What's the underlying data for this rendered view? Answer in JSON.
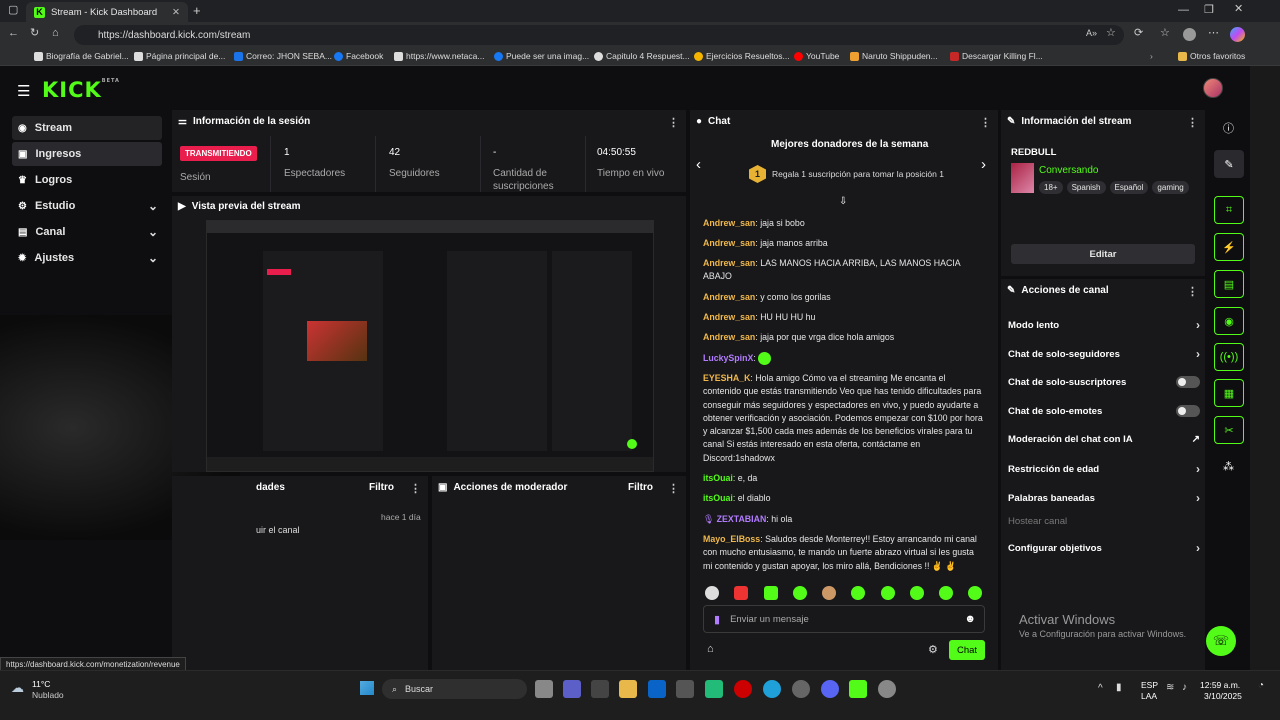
{
  "browser": {
    "tab_title": "Stream - Kick Dashboard",
    "url": "https://dashboard.kick.com/stream",
    "bookmarks": [
      "Biografía de Gabriel...",
      "Página principal de...",
      "Correo: JHON SEBA...",
      "Facebook",
      "https://www.netaca...",
      "Puede ser una imag...",
      "Capitulo 4 Respuest...",
      "Ejercicios Resueltos...",
      "YouTube",
      "Naruto Shippuden...",
      "Descargar Killing Fl...",
      "Otros favoritos"
    ],
    "status_url": "https://dashboard.kick.com/monetization/revenue"
  },
  "app": {
    "logo": "KICK",
    "logo_badge": "BETA"
  },
  "sidebar": {
    "items": [
      {
        "label": "Stream",
        "icon": "broadcast-icon"
      },
      {
        "label": "Ingresos",
        "icon": "wallet-icon"
      },
      {
        "label": "Logros",
        "icon": "trophy-icon"
      },
      {
        "label": "Estudio",
        "icon": "sliders-icon"
      },
      {
        "label": "Canal",
        "icon": "channel-icon"
      },
      {
        "label": "Ajustes",
        "icon": "gear-icon"
      }
    ]
  },
  "session": {
    "title": "Información de la sesión",
    "status_badge": "TRANSMITIENDO",
    "session_label": "Sesión",
    "viewers": "1",
    "viewers_label": "Espectadores",
    "followers": "42",
    "followers_label": "Seguidores",
    "subs": "-",
    "subs_label": "Cantidad de suscripciones",
    "time": "04:50:55",
    "time_label": "Tiempo en vivo"
  },
  "preview": {
    "title": "Vista previa del stream"
  },
  "activity": {
    "title": "dades",
    "filter": "Filtro",
    "time": "hace 1 día",
    "text": "uir el canal"
  },
  "mod_actions": {
    "title": "Acciones de moderador",
    "filter": "Filtro"
  },
  "chat": {
    "title": "Chat",
    "top_donors": "Mejores donadores de la semana",
    "donor_rank": "1",
    "donor_text": "Regala 1 suscripción para tomar la posición 1",
    "messages": [
      {
        "user": "Andrew_san",
        "text": "jaja si bobo",
        "color": "#f0b84a"
      },
      {
        "user": "Andrew_san",
        "text": "jaja manos arriba",
        "color": "#f0b84a"
      },
      {
        "user": "Andrew_san",
        "text": "LAS MANOS HACIA ARRIBA, LAS MANOS HACIA ABAJO",
        "color": "#f0b84a"
      },
      {
        "user": "Andrew_san",
        "text": "y como los gorilas",
        "color": "#f0b84a"
      },
      {
        "user": "Andrew_san",
        "text": "HU HU HU hu",
        "color": "#f0b84a"
      },
      {
        "user": "Andrew_san",
        "text": "jaja por que vrga dice hola amigos",
        "color": "#f0b84a"
      },
      {
        "user": "LuckySpinX",
        "text": "",
        "color": "#b27cff"
      },
      {
        "user": "EYESHA_K",
        "text": "Hola amigo Cómo va el streaming Me encanta el contenido que estás transmitiendo Veo que has tenido dificultades para conseguir más seguidores y espectadores en vivo, y puedo ayudarte a obtener verificación y asociación. Podemos empezar con $100 por hora y alcanzar $1,500 cada mes además de los beneficios virales para tu canal Si estás interesado en esta oferta, contáctame en Discord:1shadowx",
        "color": "#f0b84a"
      },
      {
        "user": "itsOuai",
        "text": "e, da",
        "color": "#53fc18"
      },
      {
        "user": "itsOuai",
        "text": "el diablo",
        "color": "#53fc18"
      },
      {
        "user": "ZEXTABIAN",
        "text": "hi ola",
        "color": "#b27cff"
      },
      {
        "user": "Mayo_ElBoss",
        "text": "Saludos desde Monterrey!! Estoy arrancando mi canal con mucho entusiasmo, te mando un fuerte abrazo virtual si les gusta mi contenido y gustan apoyar, los miro allá, Bendiciones !! ✌️ ✌️",
        "color": "#f0b84a"
      }
    ],
    "placeholder": "Enviar un mensaje",
    "send": "Chat"
  },
  "stream_info": {
    "title": "Información del stream",
    "stream_title": "REDBULL",
    "category": "Conversando",
    "tags": [
      "18+",
      "Spanish",
      "Español",
      "gaming"
    ],
    "edit": "Editar"
  },
  "channel_actions": {
    "title": "Acciones de canal",
    "items": [
      {
        "label": "Modo lento",
        "control": "chevron"
      },
      {
        "label": "Chat de solo-seguidores",
        "control": "chevron"
      },
      {
        "label": "Chat de solo-suscriptores",
        "control": "toggle"
      },
      {
        "label": "Chat de solo-emotes",
        "control": "toggle"
      },
      {
        "label": "Moderación del chat con IA",
        "control": "external"
      },
      {
        "label": "Restricción de edad",
        "control": "chevron"
      },
      {
        "label": "Palabras baneadas",
        "control": "chevron"
      },
      {
        "label": "Hostear canal",
        "control": "none"
      },
      {
        "label": "Configurar objetivos",
        "control": "chevron"
      }
    ]
  },
  "watermark": {
    "line1": "Activar Windows",
    "line2": "Ve a Configuración para activar Windows."
  },
  "taskbar": {
    "temp": "11°C",
    "weather": "Nublado",
    "search": "Buscar",
    "lang1": "ESP",
    "lang2": "LAA",
    "time": "12:59 a.m.",
    "date": "3/10/2025"
  },
  "colors": {
    "brand": "#53fc18",
    "live_badge": "#e91e4c"
  }
}
